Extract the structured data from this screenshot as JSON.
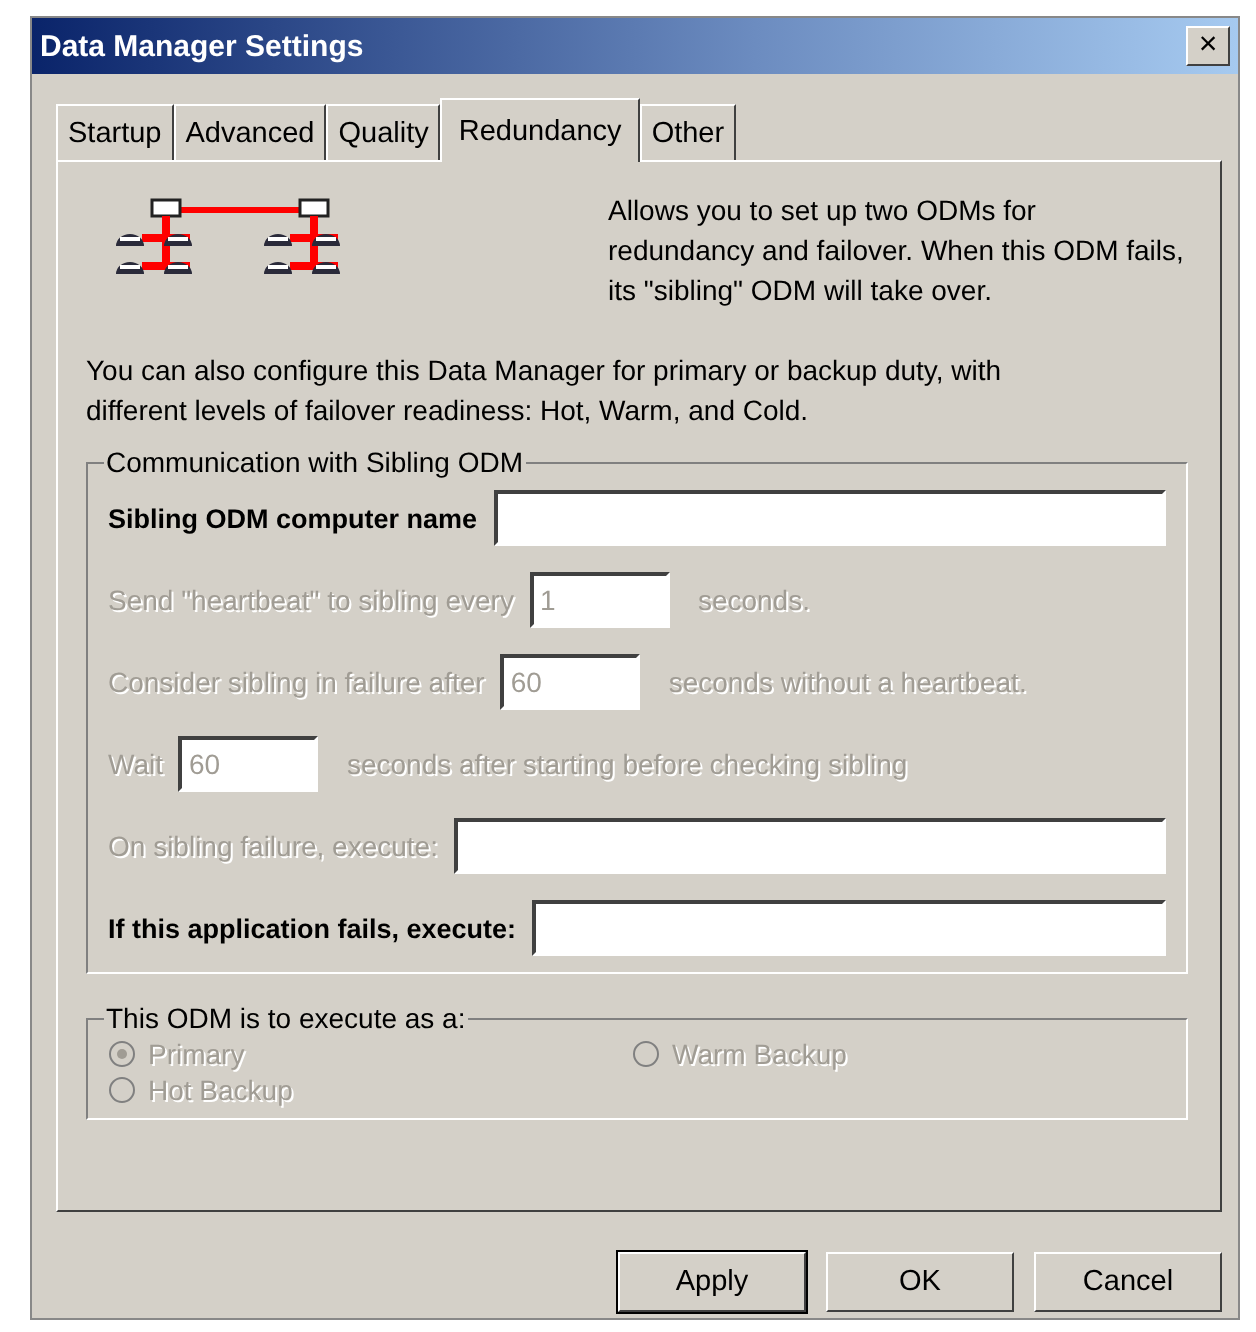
{
  "window": {
    "title": "Data Manager Settings",
    "close": "×"
  },
  "tabs": [
    {
      "label": "Startup",
      "selected": false
    },
    {
      "label": "Advanced",
      "selected": false
    },
    {
      "label": "Quality",
      "selected": false
    },
    {
      "label": "Redundancy",
      "selected": true
    },
    {
      "label": "Other",
      "selected": false
    }
  ],
  "intro": "Allows you to set up two ODMs for redundancy and failover.  When this ODM fails, its \"sibling\" ODM will take over.",
  "description": "You can also configure this Data Manager for primary or backup duty, with different levels of failover readiness: Hot, Warm, and Cold.",
  "communication": {
    "title": "Communication with Sibling ODM",
    "rows": [
      {
        "label": "Sibling ODM computer name",
        "kind": "wide",
        "disabled": false
      },
      {
        "label": "Send \"heartbeat\" to sibling every",
        "kind": "short",
        "value": "1",
        "suffix": "seconds.",
        "disabled": true
      },
      {
        "label": "Consider sibling in failure after",
        "kind": "short",
        "value": "60",
        "suffix": "seconds without a heartbeat.",
        "disabled": true
      },
      {
        "label": "Wait",
        "kind": "short",
        "value": "60",
        "suffix": "seconds after starting before checking sibling",
        "disabled": true
      },
      {
        "label": "On sibling failure, execute:",
        "kind": "wide",
        "disabled": true
      },
      {
        "label": "If this application fails, execute:",
        "kind": "wide",
        "disabled": false
      }
    ]
  },
  "role": {
    "title": "This ODM is to execute as a:",
    "options": [
      {
        "label": "Primary",
        "selected": true,
        "disabled": true
      },
      {
        "label": "Warm Backup",
        "selected": false,
        "disabled": true
      },
      {
        "label": "Hot Backup",
        "selected": false,
        "disabled": true
      }
    ]
  },
  "buttons": [
    {
      "label": "Apply",
      "default": true
    },
    {
      "label": "OK",
      "default": false
    },
    {
      "label": "Cancel",
      "default": false
    }
  ]
}
